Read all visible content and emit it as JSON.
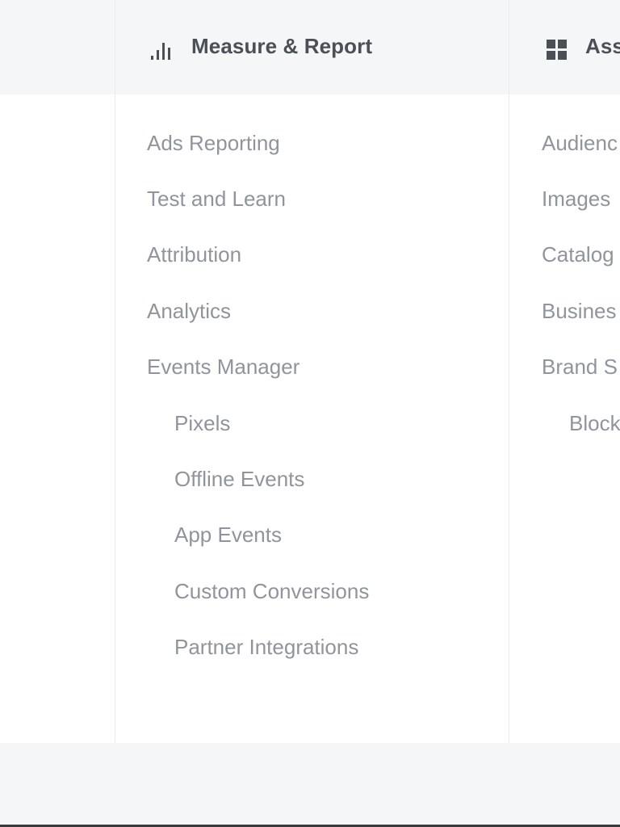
{
  "columns": {
    "measure": {
      "title": "Measure & Report",
      "icon": "bar-chart-icon",
      "items": [
        {
          "label": "Ads Reporting",
          "indent": false
        },
        {
          "label": "Test and Learn",
          "indent": false
        },
        {
          "label": "Attribution",
          "indent": false
        },
        {
          "label": "Analytics",
          "indent": false
        },
        {
          "label": "Events Manager",
          "indent": false
        },
        {
          "label": "Pixels",
          "indent": true
        },
        {
          "label": "Offline Events",
          "indent": true
        },
        {
          "label": "App Events",
          "indent": true
        },
        {
          "label": "Custom Conversions",
          "indent": true
        },
        {
          "label": "Partner Integrations",
          "indent": true
        }
      ]
    },
    "assets": {
      "title": "Ass",
      "icon": "grid-icon",
      "items": [
        {
          "label": "Audienc",
          "indent": false
        },
        {
          "label": "Images",
          "indent": false
        },
        {
          "label": "Catalog",
          "indent": false
        },
        {
          "label": "Busines",
          "indent": false
        },
        {
          "label": "Brand S",
          "indent": false
        },
        {
          "label": "Block",
          "indent": true
        }
      ]
    }
  },
  "colors": {
    "header_bg": "#f5f6f7",
    "title_text": "#4b4f56",
    "item_text": "#90949c",
    "divider": "#e9eaed"
  }
}
